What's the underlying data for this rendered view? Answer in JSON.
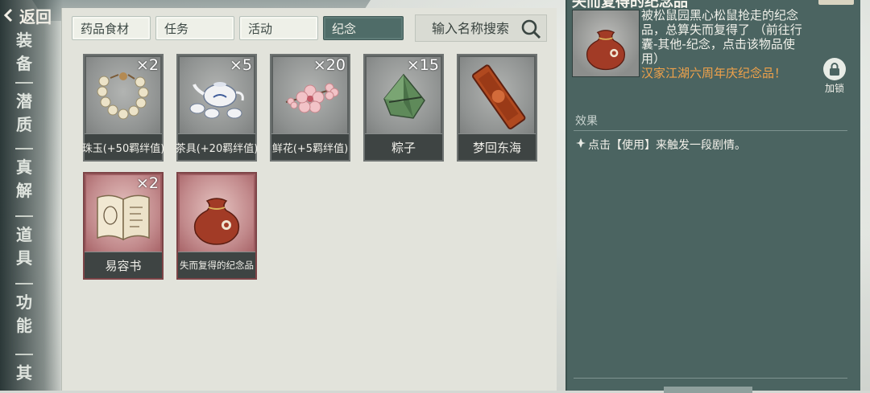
{
  "nav": {
    "back_label": "返回",
    "items": [
      {
        "label": "装备"
      },
      {
        "label": "潜质"
      },
      {
        "label": "真解"
      },
      {
        "label": "道具"
      },
      {
        "label": "功能"
      },
      {
        "label": "其"
      }
    ]
  },
  "tabs": [
    {
      "label": "药品食材"
    },
    {
      "label": "任务"
    },
    {
      "label": "活动"
    },
    {
      "label": "纪念",
      "active": true
    }
  ],
  "search": {
    "placeholder": "输入名称搜索"
  },
  "items": [
    {
      "name": "珠玉(+50羁绊值)",
      "count": "×2",
      "icon": "pearl-bracelet-icon",
      "quality": "gray"
    },
    {
      "name": "茶具(+20羁绊值)",
      "count": "×5",
      "icon": "tea-set-icon",
      "quality": "gray"
    },
    {
      "name": "鲜花(+5羁绊值)",
      "count": "×20",
      "icon": "flower-icon",
      "quality": "gray"
    },
    {
      "name": "粽子",
      "count": "×15",
      "icon": "zongzi-icon",
      "quality": "gray"
    },
    {
      "name": "梦回东海",
      "count": "",
      "icon": "red-token-icon",
      "quality": "gray"
    },
    {
      "name": "易容书",
      "count": "×2",
      "icon": "open-book-icon",
      "quality": "red"
    },
    {
      "name": "失而复得的纪念品",
      "count": "",
      "icon": "pouch-icon",
      "quality": "red"
    }
  ],
  "detail": {
    "title": "失而复得的纪念品",
    "description": "被松鼠园黑心松鼠抢走的纪念品，总算失而复得了",
    "hint": "（前往行囊-其他-纪念，点击该物品使用）",
    "source": "汉家江湖六周年庆纪念品！",
    "lock_label": "加锁",
    "effect_header": "效果",
    "effect_text": "点击【使用】来触发一段剧情。"
  },
  "colors": {
    "panel_teal": "#4b6461",
    "active_tab": "#4f6c68",
    "source_orange": "#f0a24a",
    "red_quality": "#9c5c60"
  }
}
